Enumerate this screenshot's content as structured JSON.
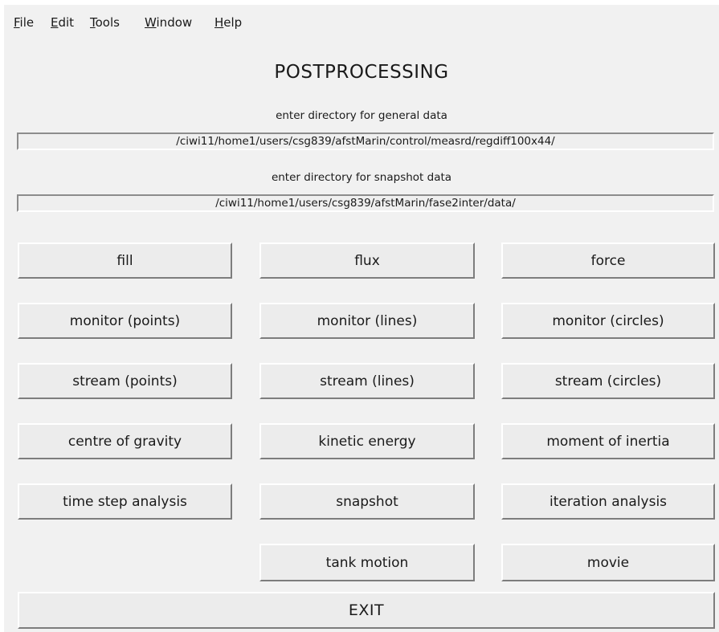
{
  "menu": {
    "items": [
      {
        "mnemonic": "F",
        "rest": "ile"
      },
      {
        "mnemonic": "E",
        "rest": "dit"
      },
      {
        "mnemonic": "T",
        "rest": "ools"
      },
      {
        "mnemonic": "W",
        "rest": "indow"
      },
      {
        "mnemonic": "H",
        "rest": "elp"
      }
    ]
  },
  "main": {
    "title": "POSTPROCESSING",
    "general_prompt": "enter directory for general data",
    "general_value": "/ciwi11/home1/users/csg839/afstMarin/control/measrd/regdiff100x44/",
    "snapshot_prompt": "enter directory for snapshot data",
    "snapshot_value": "/ciwi11/home1/users/csg839/afstMarin/fase2inter/data/"
  },
  "buttons": {
    "fill": "fill",
    "flux": "flux",
    "force": "force",
    "monitor_points": "monitor (points)",
    "monitor_lines": "monitor (lines)",
    "monitor_circles": "monitor (circles)",
    "stream_points": "stream (points)",
    "stream_lines": "stream (lines)",
    "stream_circles": "stream (circles)",
    "centre_of_gravity": "centre of gravity",
    "kinetic_energy": "kinetic energy",
    "moment_of_inertia": "moment of inertia",
    "time_step_analysis": "time step analysis",
    "snapshot": "snapshot",
    "iteration_analysis": "iteration analysis",
    "tank_motion": "tank motion",
    "movie": "movie",
    "exit": "EXIT"
  }
}
